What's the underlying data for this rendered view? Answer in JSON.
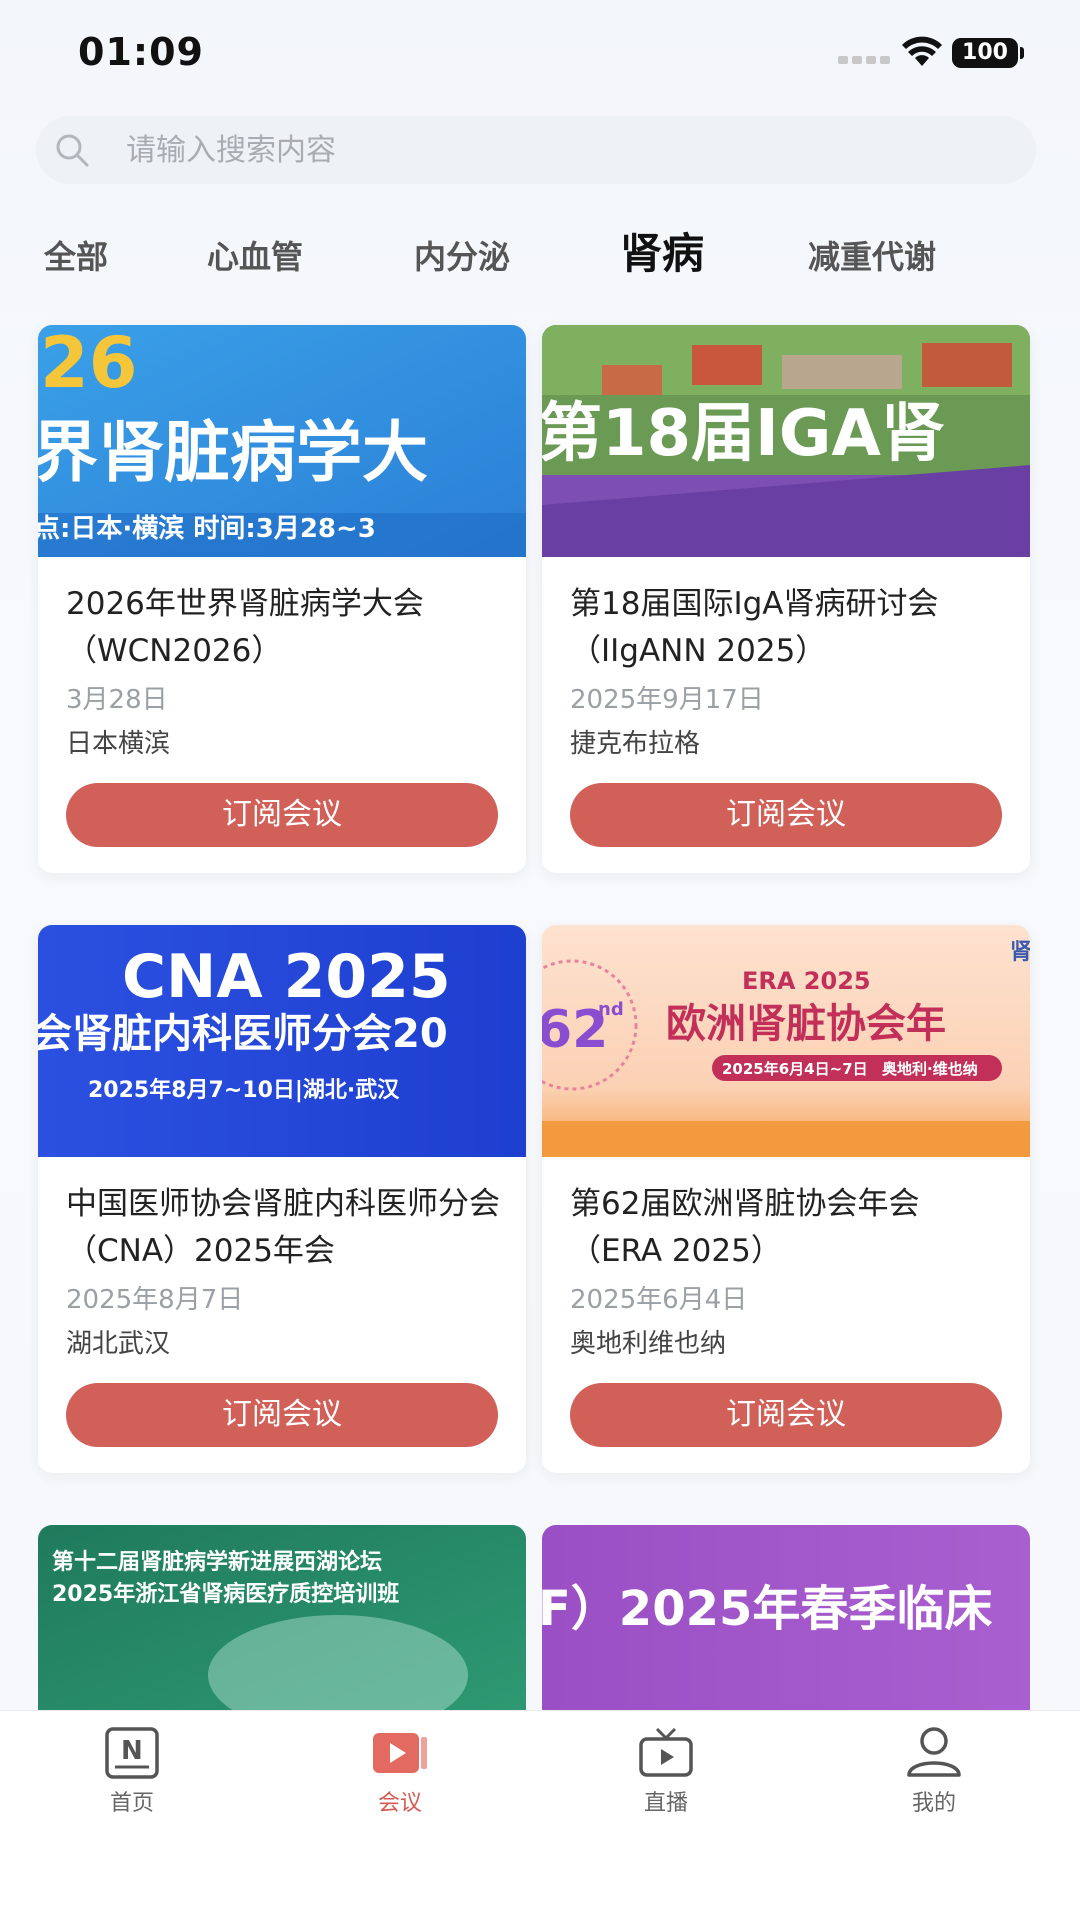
{
  "status_bar": {
    "time": "01:09",
    "battery": "100"
  },
  "search": {
    "placeholder": "请输入搜索内容"
  },
  "tabs": [
    {
      "label": "全部"
    },
    {
      "label": "心血管"
    },
    {
      "label": "内分泌"
    },
    {
      "label": "肾病",
      "active": true
    },
    {
      "label": "减重代谢"
    }
  ],
  "cards": [
    {
      "title": "2026年世界肾脏病学大会（WCN2026）",
      "date": "3月28日",
      "location": "日本横滨",
      "button": "订阅会议",
      "image_text": {
        "line1": "26",
        "line2": "界肾脏病学大",
        "line3": "点:日本·横滨   时间:3月28~3"
      }
    },
    {
      "title": "第18届国际IgA肾病研讨会（IIgANN 2025）",
      "date": "2025年9月17日",
      "location": "捷克布拉格",
      "button": "订阅会议",
      "image_text": {
        "line1": "第18届IGA肾"
      }
    },
    {
      "title": "中国医师协会肾脏内科医师分会（CNA）2025年会",
      "date": "2025年8月7日",
      "location": "湖北武汉",
      "button": "订阅会议",
      "image_text": {
        "line1": "CNA 2025",
        "line2": "会肾脏内科医师分会20",
        "line3": "2025年8月7~10日|湖北·武汉"
      }
    },
    {
      "title": "第62届欧洲肾脏协会年会（ERA 2025）",
      "date": "2025年6月4日",
      "location": "奥地利维也纳",
      "button": "订阅会议",
      "image_text": {
        "line1": "ERA 2025",
        "line2": "欧洲肾脏协会年",
        "line3": "2025年6月4日~7日",
        "line4": "奥地利·维也纳",
        "badge": "62",
        "badge_sup": "nd",
        "corner": "肾"
      }
    }
  ],
  "partial_cards": [
    {
      "image_text": {
        "line1": "第十二届肾脏病学新进展西湖论坛",
        "line2": "2025年浙江省肾病医疗质控培训班"
      }
    },
    {
      "image_text": {
        "line1": "F）2025年春季临床"
      }
    }
  ],
  "bottom_nav": [
    {
      "label": "首页",
      "icon": "news-icon"
    },
    {
      "label": "会议",
      "icon": "video-icon",
      "active": true
    },
    {
      "label": "直播",
      "icon": "tv-icon"
    },
    {
      "label": "我的",
      "icon": "user-icon"
    }
  ],
  "colors": {
    "accent": "#d06058",
    "active_nav": "#d45a52"
  }
}
